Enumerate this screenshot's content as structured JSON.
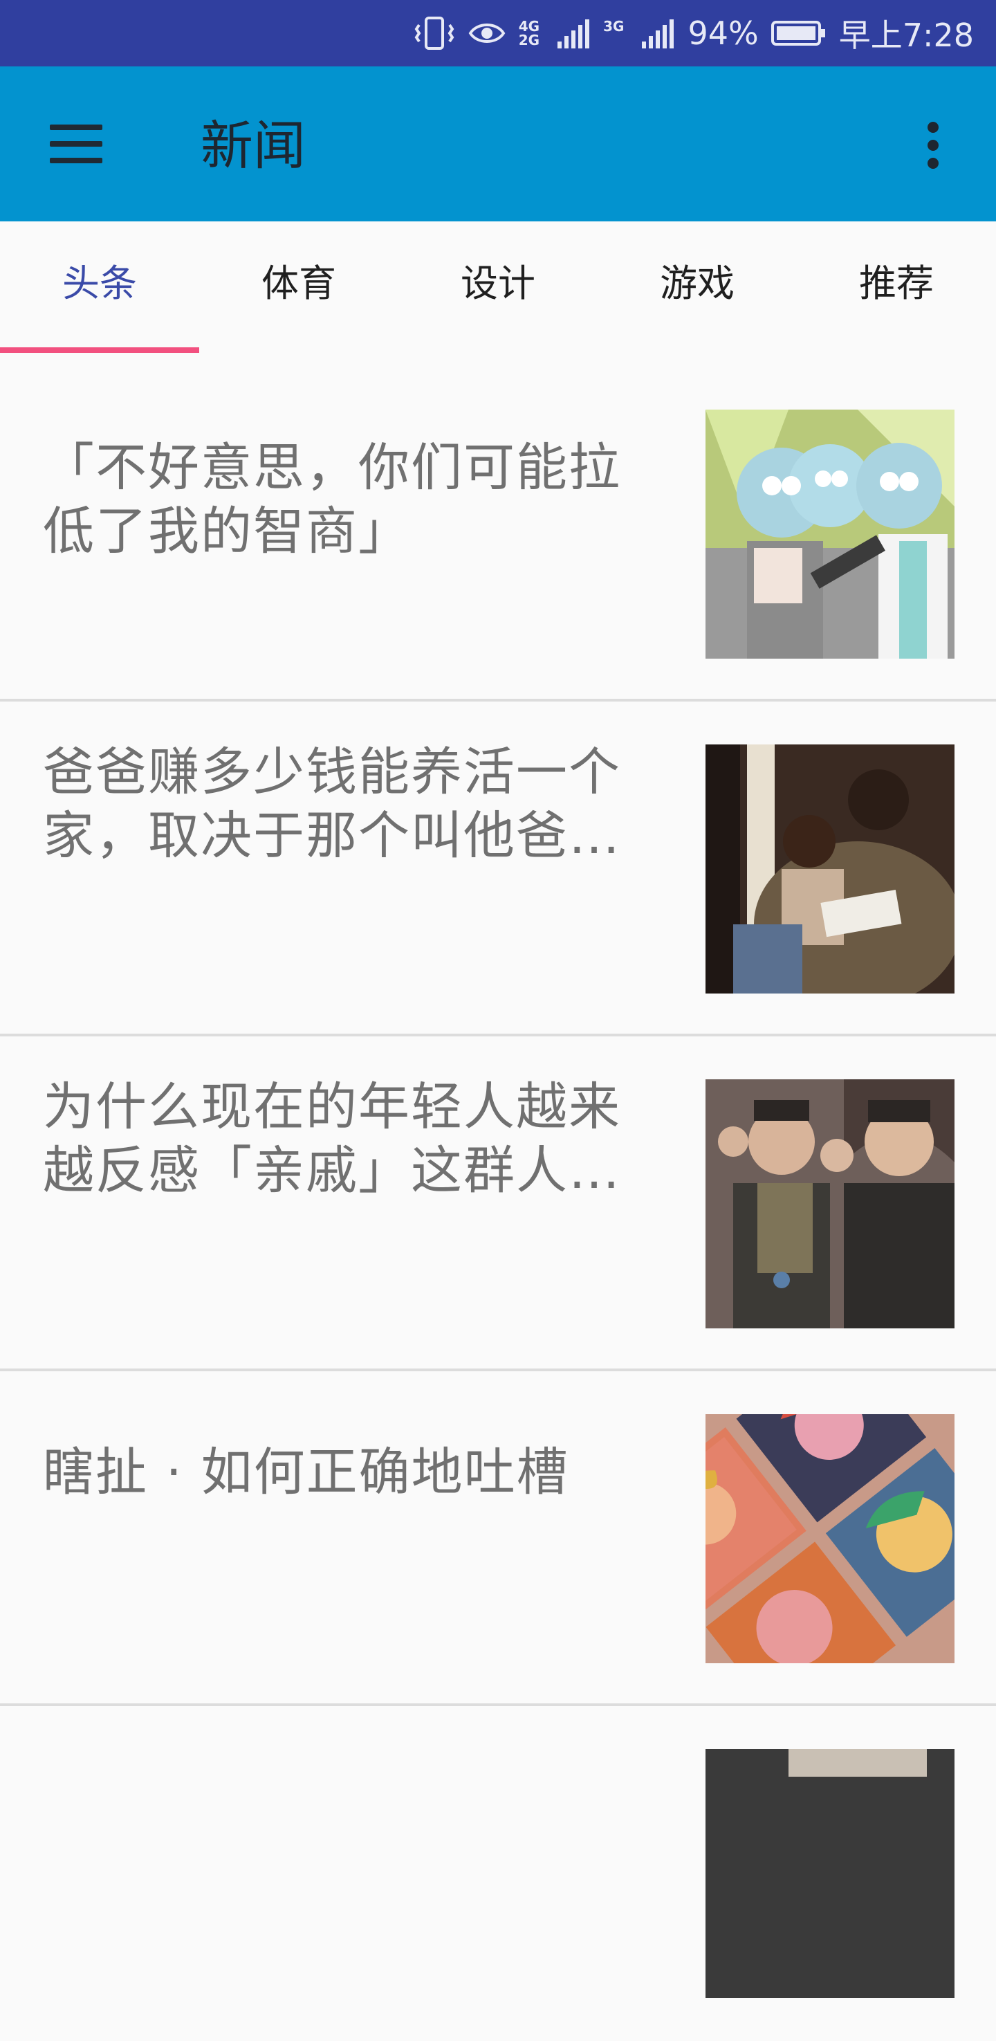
{
  "status_bar": {
    "network_top": "4G",
    "network_bottom": "2G",
    "network_3g": "3G",
    "battery": "94%",
    "time": "早上7:28"
  },
  "app_bar": {
    "title": "新闻"
  },
  "tabs": [
    {
      "label": "头条",
      "active": true
    },
    {
      "label": "体育",
      "active": false
    },
    {
      "label": "设计",
      "active": false
    },
    {
      "label": "游戏",
      "active": false
    },
    {
      "label": "推荐",
      "active": false
    }
  ],
  "news": [
    {
      "title": "「不好意思，你们可能拉低了我的智商」"
    },
    {
      "title": "爸爸赚多少钱能养活一个家，取决于那个叫他爸…"
    },
    {
      "title": "为什么现在的年轻人越来越反感「亲戚」这群人…"
    },
    {
      "title": "瞎扯 · 如何正确地吐槽"
    }
  ],
  "colors": {
    "status_bar": "#303f9f",
    "app_bar": "#0393cf",
    "tab_active": "#3a4aa8",
    "tab_indicator": "#f2507f",
    "news_text": "#707070"
  },
  "icons": [
    "menu-icon",
    "overflow-icon",
    "vibrate-icon",
    "eye-icon",
    "signal-icon",
    "battery-icon"
  ]
}
